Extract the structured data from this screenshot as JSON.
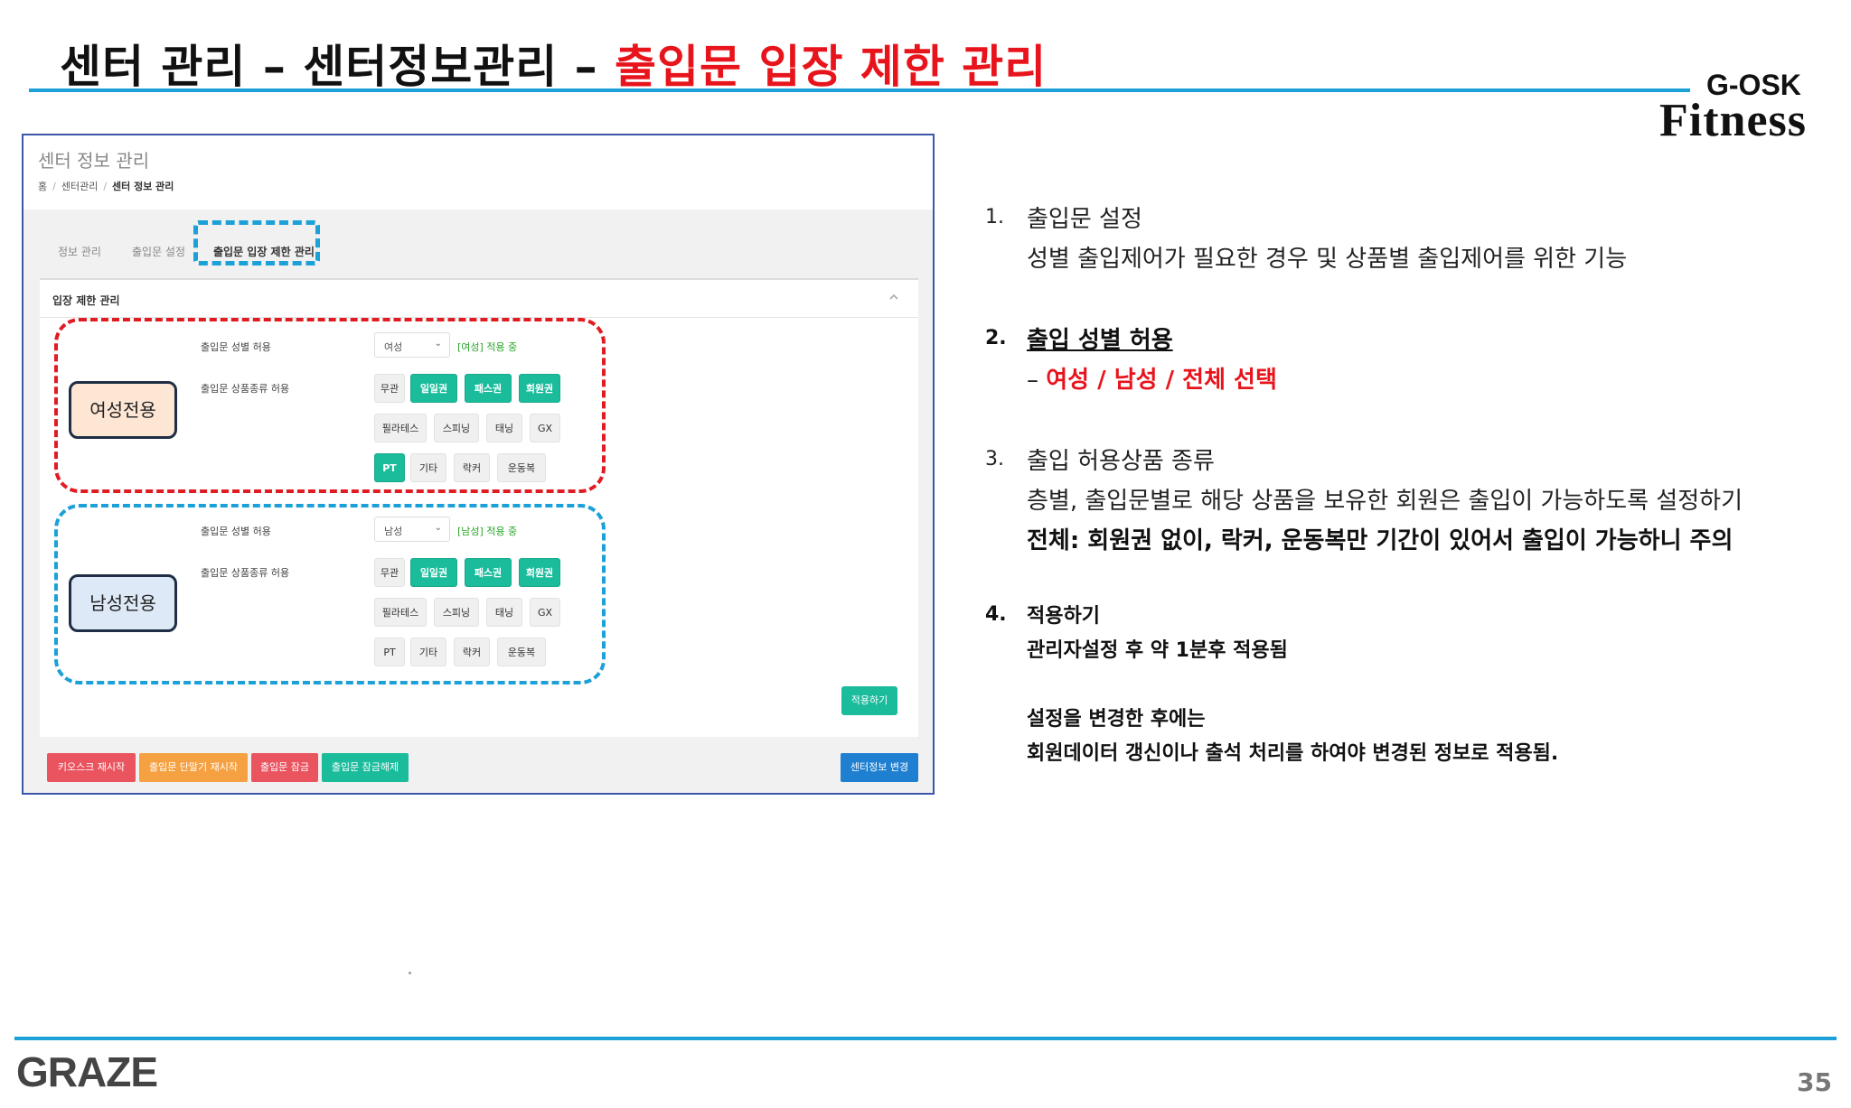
{
  "slide": {
    "title_prefix": "센터 관리 – 센터정보관리 – ",
    "title_accent": "출입문 입장 제한 관리",
    "brand_top": "G-OSK",
    "brand_main": "Fitness",
    "footer_logo": "GRAZE",
    "page_number": "35",
    "accent_color": "#e8141c",
    "rule_color": "#1ba0d8"
  },
  "app": {
    "title": "센터 정보 관리",
    "breadcrumb": [
      "홈",
      "센터관리",
      "센터 정보 관리"
    ],
    "tabs": [
      "정보 관리",
      "출입문 설정",
      "출입문 입장 제한 관리"
    ],
    "active_tab": "출입문 입장 제한 관리",
    "panel_title": "입장 제한 관리",
    "female": {
      "gender_label": "출입문 성별 허용",
      "gender_value": "여성",
      "status": "[여성] 적용 중",
      "products_label": "출입문 상품종류 허용",
      "chips": [
        {
          "label": "무관",
          "on": false
        },
        {
          "label": "일일권",
          "on": true
        },
        {
          "label": "패스권",
          "on": true
        },
        {
          "label": "회원권",
          "on": true
        },
        {
          "label": "필라테스",
          "on": false
        },
        {
          "label": "스피닝",
          "on": false
        },
        {
          "label": "태닝",
          "on": false
        },
        {
          "label": "GX",
          "on": false
        },
        {
          "label": "PT",
          "on": true
        },
        {
          "label": "기타",
          "on": false
        },
        {
          "label": "락커",
          "on": false
        },
        {
          "label": "운동복",
          "on": false
        }
      ]
    },
    "male": {
      "gender_label": "출입문 성별 허용",
      "gender_value": "남성",
      "status": "[남성] 적용 중",
      "products_label": "출입문 상품종류 허용",
      "chips": [
        {
          "label": "무관",
          "on": false
        },
        {
          "label": "일일권",
          "on": true
        },
        {
          "label": "패스권",
          "on": true
        },
        {
          "label": "회원권",
          "on": true
        },
        {
          "label": "필라테스",
          "on": false
        },
        {
          "label": "스피닝",
          "on": false
        },
        {
          "label": "태닝",
          "on": false
        },
        {
          "label": "GX",
          "on": false
        },
        {
          "label": "PT",
          "on": false
        },
        {
          "label": "기타",
          "on": false
        },
        {
          "label": "락커",
          "on": false
        },
        {
          "label": "운동복",
          "on": false
        }
      ]
    },
    "apply_button": "적용하기",
    "bottom_buttons": [
      {
        "label": "키오스크 재시작",
        "color": "#e9545f"
      },
      {
        "label": "출입문 단말기 재시작",
        "color": "#f5a142"
      },
      {
        "label": "출입문 잠금",
        "color": "#e9545f"
      },
      {
        "label": "출입문 잠금해제",
        "color": "#1abc9c"
      }
    ],
    "center_info_button": {
      "label": "센터정보 변경",
      "color": "#1f7fd1"
    }
  },
  "annotations": {
    "female_tag": "여성전용",
    "male_tag": "남성전용"
  },
  "notes": {
    "n1_num": "1.",
    "n1_title": "출입문 설정",
    "n1_desc": "성별 출입제어가 필요한 경우 및 상품별 출입제어를 위한 기능",
    "n2_num": "2.",
    "n2_title": "출입 성별 허용",
    "n2_dash": "– ",
    "n2_desc": "여성 / 남성 / 전체 선택",
    "n3_num": "3.",
    "n3_title": "출입 허용상품 종류",
    "n3_desc": "층별, 출입문별로 해당 상품을 보유한 회원은 출입이 가능하도록 설정하기",
    "n3_warn": "전체: 회원권 없이, 락커, 운동복만 기간이 있어서 출입이 가능하니 주의",
    "n4_num": "4.",
    "n4_title": "적용하기",
    "n4_desc": "관리자설정 후 약 1분후 적용됨",
    "n4_desc2": "설정을 변경한 후에는",
    "n4_desc3": "회원데이터 갱신이나 출석 처리를 하여야 변경된 정보로 적용됨."
  }
}
